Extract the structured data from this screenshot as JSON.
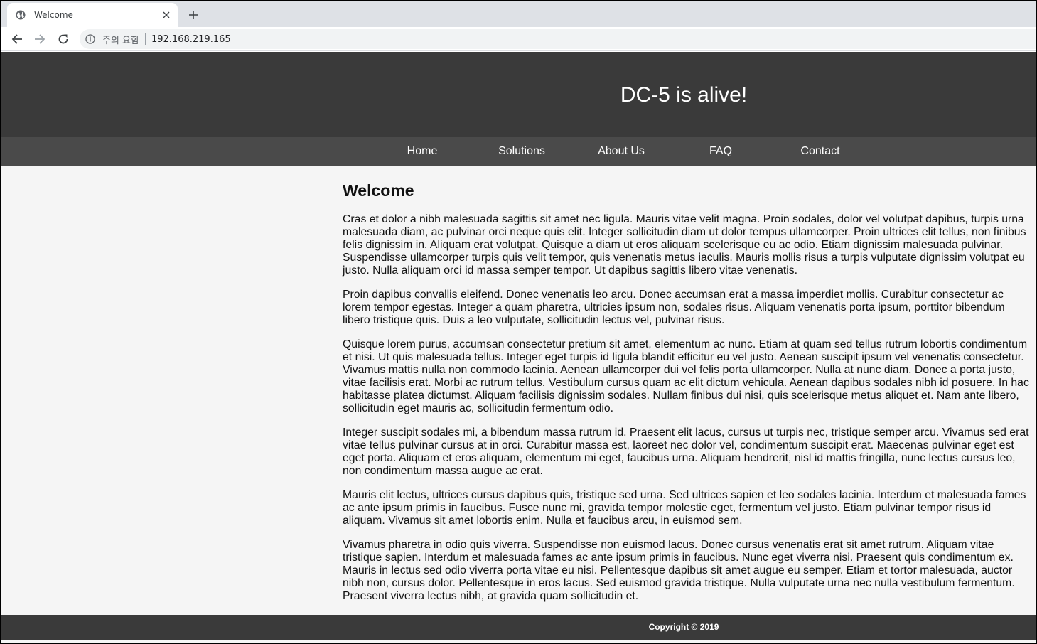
{
  "browser": {
    "tab": {
      "title": "Welcome"
    },
    "omnibox": {
      "security": "주의 요함",
      "url": "192.168.219.165"
    }
  },
  "site": {
    "title": "DC-5 is alive!",
    "nav": [
      {
        "label": "Home"
      },
      {
        "label": "Solutions"
      },
      {
        "label": "About Us"
      },
      {
        "label": "FAQ"
      },
      {
        "label": "Contact"
      }
    ],
    "heading": "Welcome",
    "paragraphs": [
      "Cras et dolor a nibh malesuada sagittis sit amet nec ligula. Mauris vitae velit magna. Proin sodales, dolor vel volutpat dapibus, turpis urna malesuada diam, ac pulvinar orci neque quis elit. Integer sollicitudin diam ut dolor tempus ullamcorper. Proin ultrices elit tellus, non finibus felis dignissim in. Aliquam erat volutpat. Quisque a diam ut eros aliquam scelerisque eu ac odio. Etiam dignissim malesuada pulvinar. Suspendisse ullamcorper turpis quis velit tempor, quis venenatis metus iaculis. Mauris mollis risus a turpis vulputate dignissim volutpat eu justo. Nulla aliquam orci id massa semper tempor. Ut dapibus sagittis libero vitae venenatis.",
      "Proin dapibus convallis eleifend. Donec venenatis leo arcu. Donec accumsan erat a massa imperdiet mollis. Curabitur consectetur ac lorem tempor egestas. Integer a quam pharetra, ultricies ipsum non, sodales risus. Aliquam venenatis porta ipsum, porttitor bibendum libero tristique quis. Duis a leo vulputate, sollicitudin lectus vel, pulvinar risus.",
      "Quisque lorem purus, accumsan consectetur pretium sit amet, elementum ac nunc. Etiam at quam sed tellus rutrum lobortis condimentum et nisi. Ut quis malesuada tellus. Integer eget turpis id ligula blandit efficitur eu vel justo. Aenean suscipit ipsum vel venenatis consectetur. Vivamus mattis nulla non commodo lacinia. Aenean ullamcorper dui vel felis porta ullamcorper. Nulla at nunc diam. Donec a porta justo, vitae facilisis erat. Morbi ac rutrum tellus. Vestibulum cursus quam ac elit dictum vehicula. Aenean dapibus sodales nibh id posuere. In hac habitasse platea dictumst. Aliquam facilisis dignissim sodales. Nullam finibus dui nisi, quis scelerisque metus aliquet et. Nam ante libero, sollicitudin eget mauris ac, sollicitudin fermentum odio.",
      "Integer suscipit sodales mi, a bibendum massa rutrum id. Praesent elit lacus, cursus ut turpis nec, tristique semper arcu. Vivamus sed erat vitae tellus pulvinar cursus at in orci. Curabitur massa est, laoreet nec dolor vel, condimentum suscipit erat. Maecenas pulvinar eget est eget porta. Aliquam et eros aliquam, elementum mi eget, faucibus urna. Aliquam hendrerit, nisl id mattis fringilla, nunc lectus cursus leo, non condimentum massa augue ac erat.",
      "Mauris elit lectus, ultrices cursus dapibus quis, tristique sed urna. Sed ultrices sapien et leo sodales lacinia. Interdum et malesuada fames ac ante ipsum primis in faucibus. Fusce nunc mi, gravida tempor molestie eget, fermentum vel justo. Etiam pulvinar tempor risus id aliquam. Vivamus sit amet lobortis enim. Nulla et faucibus arcu, in euismod sem.",
      "Vivamus pharetra in odio quis viverra. Suspendisse non euismod lacus. Donec cursus venenatis erat sit amet rutrum. Aliquam vitae tristique sapien. Interdum et malesuada fames ac ante ipsum primis in faucibus. Nunc eget viverra nisi. Praesent quis condimentum ex. Mauris in lectus sed odio viverra porta vitae eu nisi. Pellentesque dapibus sit amet augue eu semper. Etiam et tortor malesuada, auctor nibh non, cursus dolor. Pellentesque in eros lacus. Sed euismod gravida tristique. Nulla vulputate urna nec nulla vestibulum fermentum. Praesent viverra lectus nibh, at gravida quam sollicitudin et."
    ],
    "footer": "Copyright © 2019"
  }
}
